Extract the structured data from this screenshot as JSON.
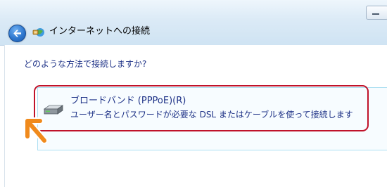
{
  "window": {
    "title": "インターネットへの接続"
  },
  "content": {
    "question": "どのような方法で接続しますか?"
  },
  "option": {
    "title": "ブロードバンド (PPPoE)(R)",
    "description": "ユーザー名とパスワードが必要な DSL またはケーブルを使って接続します",
    "icon": "broadband-drive-icon"
  },
  "annotation": {
    "highlight_color": "#c0122a",
    "arrow_color": "#f08a1c"
  },
  "icons": {
    "back": "back-arrow-icon",
    "network": "network-globe-icon",
    "minimize": "minimize-icon"
  }
}
